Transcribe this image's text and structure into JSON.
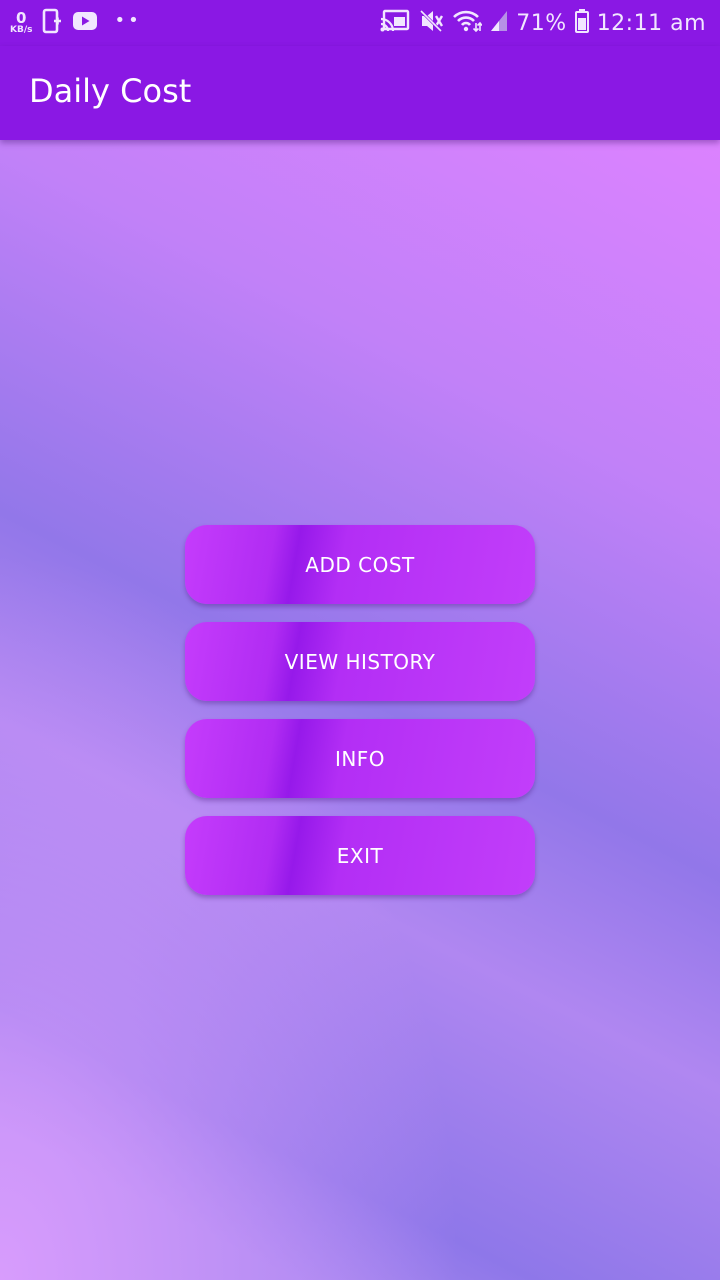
{
  "status_bar": {
    "net_speed_value": "0",
    "net_speed_unit": "KB/s",
    "notification_dots": "••",
    "battery_percent": "71%",
    "time": "12:11 am"
  },
  "app_bar": {
    "title": "Daily Cost"
  },
  "menu": {
    "buttons": [
      {
        "label": "ADD COST"
      },
      {
        "label": "VIEW HISTORY"
      },
      {
        "label": "INFO"
      },
      {
        "label": "EXIT"
      }
    ]
  },
  "colors": {
    "primary": "#8a18e4",
    "button": "#b12cf3",
    "text": "#ffffff"
  }
}
